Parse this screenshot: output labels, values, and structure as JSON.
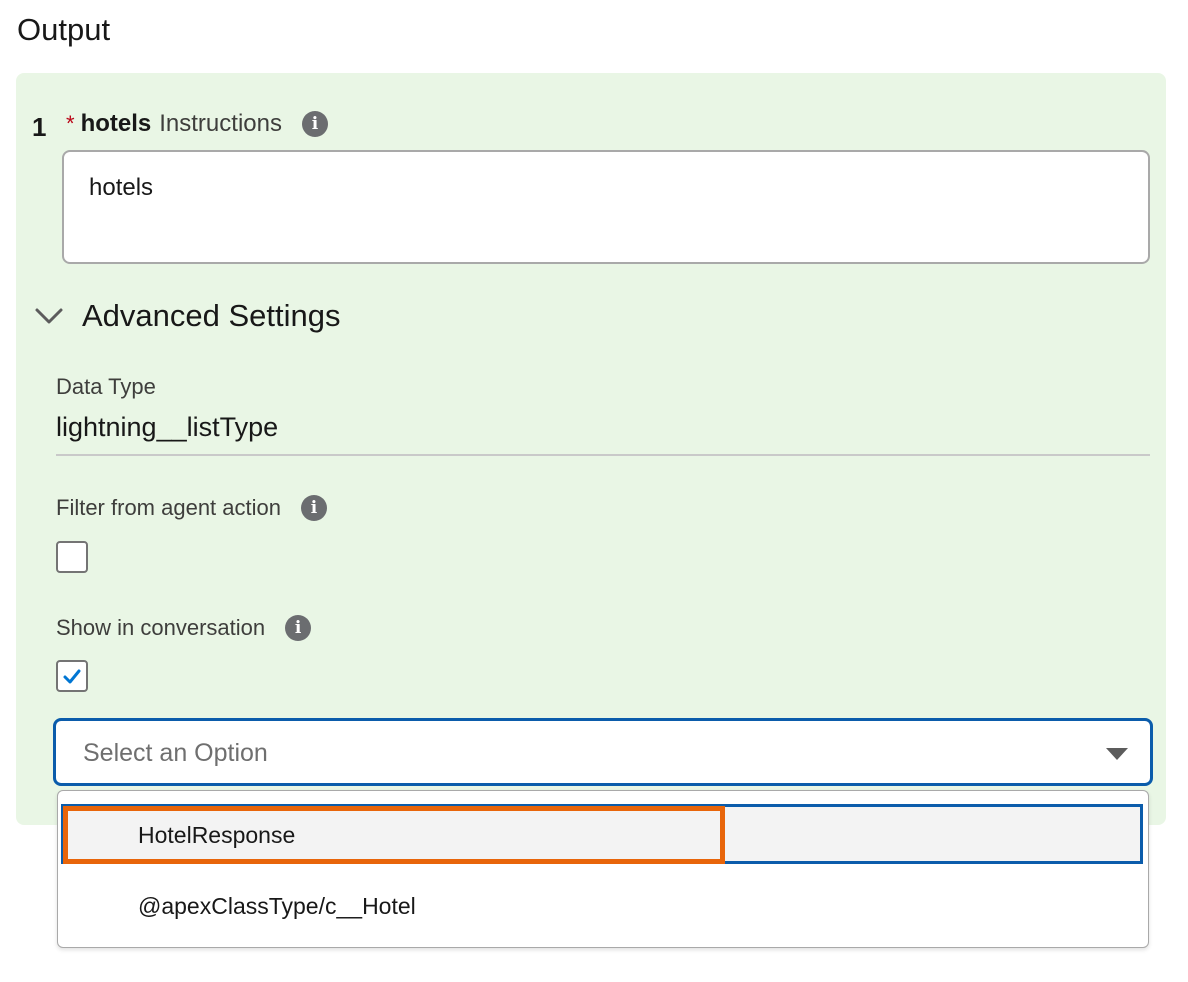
{
  "section": {
    "title": "Output"
  },
  "item": {
    "number": "1",
    "required_marker": "*",
    "name": "hotels",
    "label_suffix": "Instructions",
    "instructions_value": "hotels"
  },
  "advanced": {
    "title": "Advanced Settings",
    "expanded": true,
    "data_type_label": "Data Type",
    "data_type_value": "lightning__listType",
    "filter_label": "Filter from agent action",
    "filter_checked": false,
    "show_label": "Show in conversation",
    "show_checked": true
  },
  "select": {
    "placeholder": "Select an Option",
    "options": [
      "HotelResponse",
      "@apexClassType/c__Hotel"
    ],
    "highlighted": "HotelResponse"
  },
  "icons": {
    "info": "info-icon",
    "chevron": "chevron-down-icon",
    "check": "check-icon",
    "caret": "caret-down-icon"
  },
  "colors": {
    "panel_bg": "#e9f6e5",
    "required": "#ba0517",
    "focus_blue": "#0b5cab",
    "highlight_orange": "#e8650a"
  }
}
